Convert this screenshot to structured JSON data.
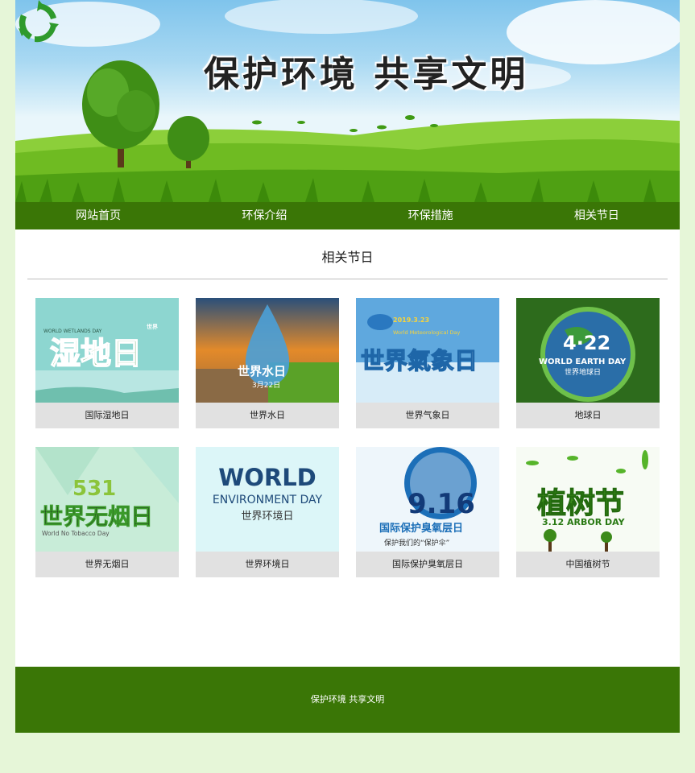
{
  "banner": {
    "title": "保护环境  共享文明"
  },
  "nav": {
    "items": [
      {
        "label": "网站首页"
      },
      {
        "label": "环保介绍"
      },
      {
        "label": "环保措施"
      },
      {
        "label": "相关节日"
      }
    ]
  },
  "section": {
    "title": "相关节日"
  },
  "cards": [
    {
      "caption": "国际湿地日",
      "art_text": "湿地日",
      "art_sub": "WORLD WETLANDS DAY",
      "art_extra": "世界"
    },
    {
      "caption": "世界水日",
      "art_text": "世界水日",
      "art_sub": "3月22日"
    },
    {
      "caption": "世界气象日",
      "art_text": "世界氣象日",
      "art_sub": "2019.3.23",
      "art_extra": "World Meteorological Day"
    },
    {
      "caption": "地球日",
      "art_text": "4·22",
      "art_sub": "WORLD EARTH DAY",
      "art_extra": "世界地球日"
    },
    {
      "caption": "世界无烟日",
      "art_text": "世界无烟日",
      "art_sub": "531",
      "art_extra": "World No Tobacco Day"
    },
    {
      "caption": "世界环境日",
      "art_text": "WORLD",
      "art_sub": "ENVIRONMENT DAY",
      "art_extra": "世界环境日"
    },
    {
      "caption": "国际保护臭氧层日",
      "art_text": "9.16",
      "art_sub": "国际保护臭氧层日",
      "art_extra": "保护我们的“保护伞”"
    },
    {
      "caption": "中国植树节",
      "art_text": "植树节",
      "art_sub": "3.12 ARBOR DAY"
    }
  ],
  "footer": {
    "text": "保护环境 共享文明"
  },
  "colors": {
    "nav_bg": "#3a7606",
    "page_bg": "#e6f6d8",
    "caption_bg": "#e1e1e1"
  }
}
